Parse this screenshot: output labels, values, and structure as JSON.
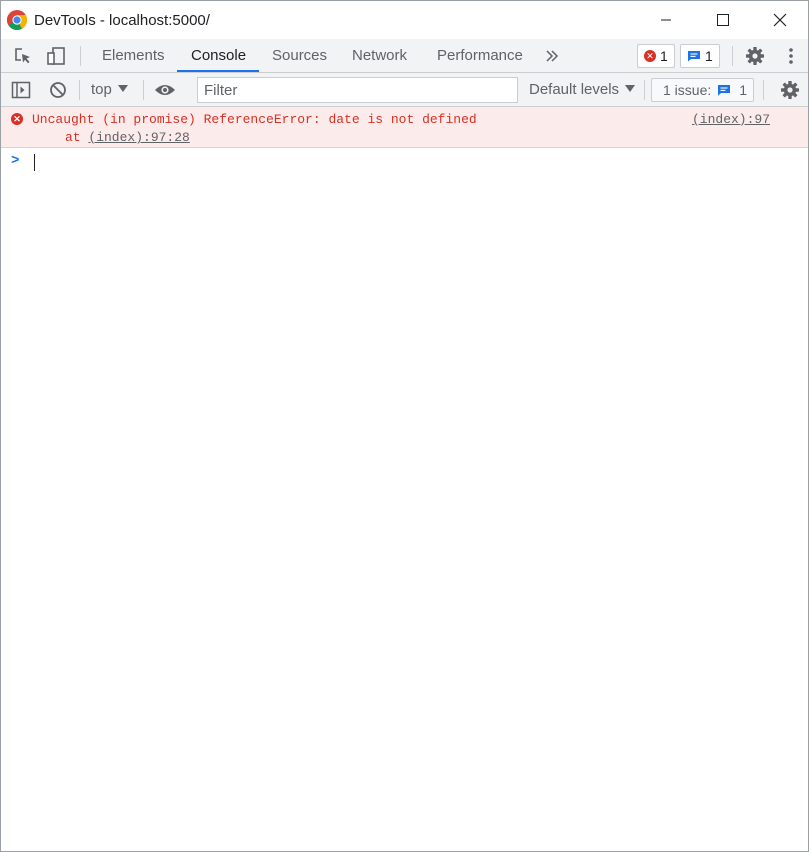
{
  "window": {
    "title": "DevTools - localhost:5000/"
  },
  "tabs": [
    {
      "label": "Elements",
      "active": false
    },
    {
      "label": "Console",
      "active": true
    },
    {
      "label": "Sources",
      "active": false
    },
    {
      "label": "Network",
      "active": false
    },
    {
      "label": "Performance",
      "active": false
    }
  ],
  "badges": {
    "errors_count": "1",
    "messages_count": "1"
  },
  "console_toolbar": {
    "context": "top",
    "filter_placeholder": "Filter",
    "levels": "Default levels",
    "issues_label": "1 issue:",
    "issues_count": "1"
  },
  "messages": [
    {
      "level": "error",
      "text": "Uncaught (in promise) ReferenceError: date is not defined",
      "source": "(index):97",
      "stack_prefix": "at ",
      "stack_link": "(index):97:28"
    }
  ],
  "icons": {
    "inspect": "inspect-element-icon",
    "device": "device-toggle-icon",
    "more_tabs": "chevron-double-right-icon",
    "settings": "gear-icon",
    "menu": "kebab-menu-icon",
    "sidebar": "sidebar-toggle-icon",
    "clear": "clear-console-icon",
    "eye": "eye-icon"
  },
  "colors": {
    "accent": "#1a73e8",
    "error": "#d93025",
    "error_bg": "#fcebeb",
    "toolbar_bg": "#f1f3f4"
  }
}
